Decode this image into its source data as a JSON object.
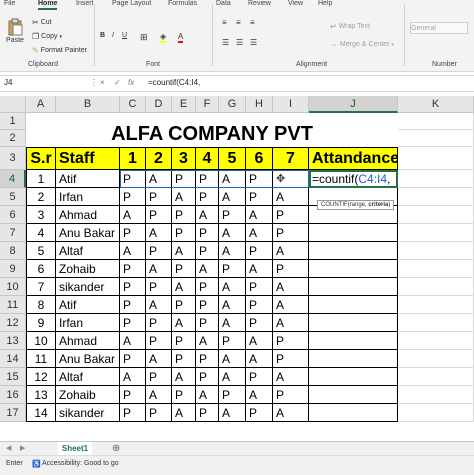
{
  "ribbon": {
    "tabs": [
      "File",
      "Home",
      "Insert",
      "Page Layout",
      "Formulas",
      "Data",
      "Review",
      "View",
      "Help"
    ],
    "active_tab": "Home",
    "paste_label": "Paste",
    "cut_label": "Cut",
    "copy_label": "Copy",
    "format_painter_label": "Format Painter",
    "clipboard_group": "Clipboard",
    "font_group": "Font",
    "alignment_group": "Alignment",
    "number_group": "Number",
    "wrap_text_label": "Wrap Text",
    "merge_center_label": "Merge & Center",
    "number_format": "General",
    "bold_label": "B",
    "italic_label": "I",
    "underline_label": "U"
  },
  "formula_bar": {
    "name_box": "J4",
    "cancel_icon": "×",
    "enter_icon": "✓",
    "fx_label": "fx",
    "formula": "=countif(C4:I4,"
  },
  "columns": [
    "A",
    "B",
    "C",
    "D",
    "E",
    "F",
    "G",
    "H",
    "I",
    "J",
    "K"
  ],
  "rows": [
    "1",
    "2",
    "3",
    "4",
    "5",
    "6",
    "7",
    "8",
    "9",
    "10",
    "11",
    "12",
    "13",
    "14",
    "15",
    "16",
    "17"
  ],
  "sheet": {
    "title": "ALFA COMPANY PVT",
    "headers": [
      "S.r",
      "Staff",
      "1",
      "2",
      "3",
      "4",
      "5",
      "6",
      "7",
      "Attandance"
    ],
    "data": [
      {
        "sr": "1",
        "staff": "Atif",
        "days": [
          "P",
          "A",
          "P",
          "P",
          "A",
          "P",
          ""
        ]
      },
      {
        "sr": "2",
        "staff": "Irfan",
        "days": [
          "P",
          "P",
          "A",
          "P",
          "A",
          "P",
          "A"
        ]
      },
      {
        "sr": "3",
        "staff": "Ahmad",
        "days": [
          "A",
          "P",
          "P",
          "A",
          "P",
          "A",
          "P"
        ]
      },
      {
        "sr": "4",
        "staff": "Anu Bakar",
        "days": [
          "P",
          "A",
          "P",
          "P",
          "A",
          "A",
          "P"
        ]
      },
      {
        "sr": "5",
        "staff": "Altaf",
        "days": [
          "A",
          "P",
          "A",
          "P",
          "A",
          "P",
          "A"
        ]
      },
      {
        "sr": "6",
        "staff": "Zohaib",
        "days": [
          "P",
          "A",
          "P",
          "A",
          "P",
          "A",
          "P"
        ]
      },
      {
        "sr": "7",
        "staff": "sikander",
        "days": [
          "P",
          "P",
          "A",
          "P",
          "A",
          "P",
          "A"
        ]
      },
      {
        "sr": "8",
        "staff": "Atif",
        "days": [
          "P",
          "A",
          "P",
          "P",
          "A",
          "P",
          "A"
        ]
      },
      {
        "sr": "9",
        "staff": "Irfan",
        "days": [
          "P",
          "P",
          "A",
          "P",
          "A",
          "P",
          "A"
        ]
      },
      {
        "sr": "10",
        "staff": "Ahmad",
        "days": [
          "A",
          "P",
          "P",
          "A",
          "P",
          "A",
          "P"
        ]
      },
      {
        "sr": "11",
        "staff": "Anu Bakar",
        "days": [
          "P",
          "A",
          "P",
          "P",
          "A",
          "A",
          "P"
        ]
      },
      {
        "sr": "12",
        "staff": "Altaf",
        "days": [
          "A",
          "P",
          "A",
          "P",
          "A",
          "P",
          "A"
        ]
      },
      {
        "sr": "13",
        "staff": "Zohaib",
        "days": [
          "P",
          "A",
          "P",
          "A",
          "P",
          "A",
          "P"
        ]
      },
      {
        "sr": "14",
        "staff": "sikander",
        "days": [
          "P",
          "P",
          "A",
          "P",
          "A",
          "P",
          "A"
        ]
      }
    ],
    "editing_formula_prefix": "=countif(",
    "editing_formula_range": "C4:I4",
    "editing_formula_suffix": ",",
    "tooltip_fn": "COUNTIF(",
    "tooltip_arg1": "range",
    "tooltip_sep": ", ",
    "tooltip_arg2": "criteria",
    "tooltip_close": ")"
  },
  "sheet_tabs": [
    "Sheet1"
  ],
  "add_sheet": "⊕",
  "status": {
    "ready": "Enter",
    "accessibility": "Accessibility: Good to go"
  },
  "colors": {
    "header_fill": "#ffff00",
    "excel_green": "#217346",
    "formula_range": "#1f5fbf"
  }
}
